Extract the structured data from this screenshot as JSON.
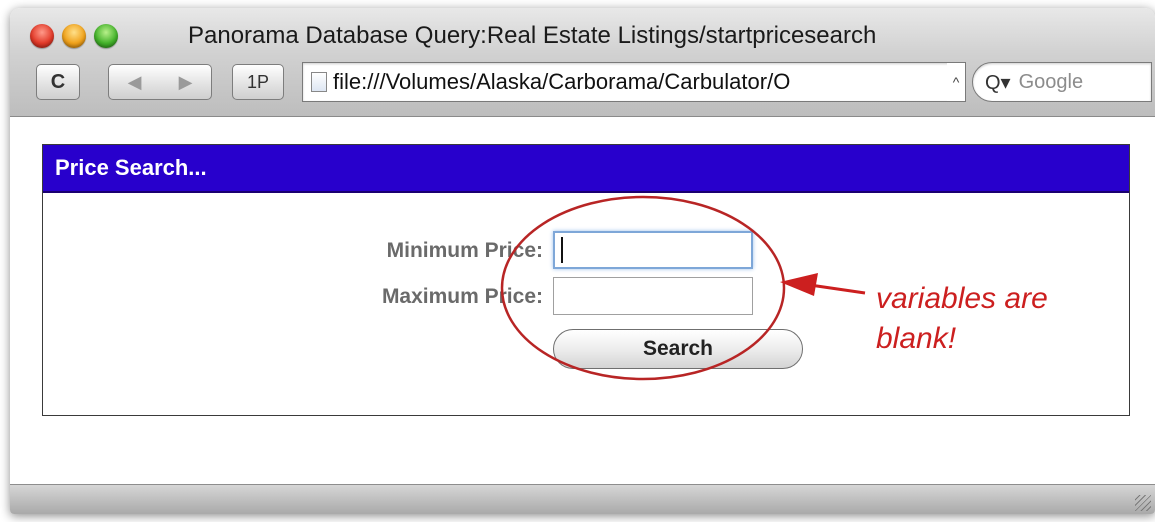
{
  "window": {
    "title": "Panorama Database Query:Real Estate Listings/startpricesearch"
  },
  "toolbar": {
    "reload_icon": "reload-icon",
    "reload_glyph": "C",
    "back_glyph": "◀",
    "forward_glyph": "▶",
    "onepassword_label": "1P",
    "url": "file:///Volumes/Alaska/Carborama/Carbulator/O",
    "url_dropdown_glyph": "^",
    "search_icon_glyph": "Q▾",
    "search_placeholder": "Google"
  },
  "form": {
    "header": "Price Search...",
    "min_label": "Minimum Price:",
    "min_value": "",
    "max_label": "Maximum Price:",
    "max_value": "",
    "submit_label": "Search"
  },
  "annotation": {
    "line1": "variables are",
    "line2": "blank!",
    "color": "#cc1f1f"
  },
  "colors": {
    "panel_header": "#2800cc",
    "label_text": "#6a6a6a"
  }
}
